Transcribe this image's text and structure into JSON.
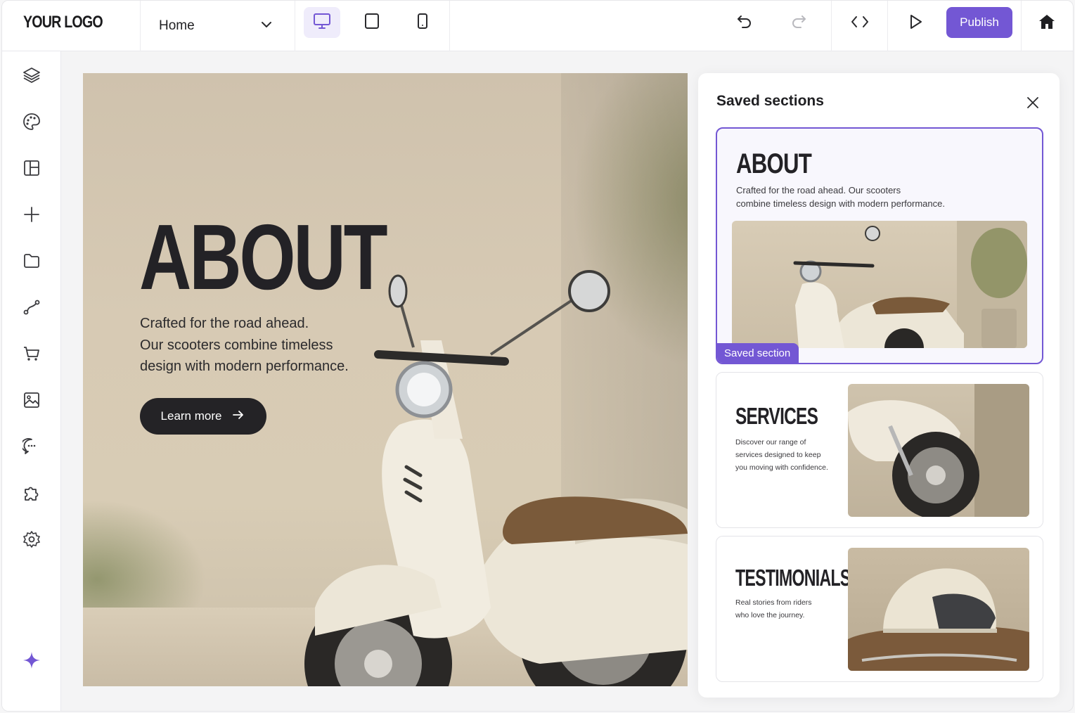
{
  "topbar": {
    "logo": "YOUR LOGO",
    "page_select": "Home",
    "publish_label": "Publish"
  },
  "hero": {
    "heading": "ABOUT",
    "body_line1": "Crafted for the road ahead.",
    "body_line2": "Our scooters combine timeless",
    "body_line3": "design with modern performance.",
    "button_label": "Learn more"
  },
  "panel": {
    "title": "Saved sections",
    "cards": [
      {
        "heading": "ABOUT",
        "text_line1": "Crafted for the road ahead. Our scooters",
        "text_line2": "combine timeless design with modern performance.",
        "badge": "Saved section"
      },
      {
        "heading": "SERVICES",
        "text_line1": "Discover our range of",
        "text_line2": "services designed to keep",
        "text_line3": "you moving with confidence."
      },
      {
        "heading": "TESTIMONIALS",
        "text_line1": "Real stories from riders",
        "text_line2": "who love the journey."
      }
    ]
  },
  "colors": {
    "accent": "#7357d4",
    "accent_light": "#efecfb",
    "dark_button": "#242326"
  },
  "icons": {
    "sidebar": [
      "layers-icon",
      "palette-icon",
      "layout-icon",
      "plus-icon",
      "folder-icon",
      "route-icon",
      "cart-icon",
      "image-icon",
      "chat-icon",
      "puzzle-icon",
      "settings-icon",
      "sparkle-icon"
    ],
    "toolbar": [
      "desktop-icon",
      "tablet-icon",
      "mobile-icon",
      "undo-icon",
      "redo-icon",
      "code-icon",
      "play-icon",
      "home-icon"
    ]
  }
}
